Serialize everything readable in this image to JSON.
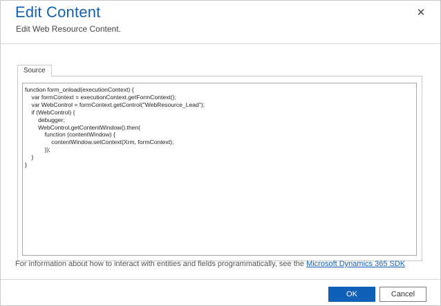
{
  "dialog": {
    "title": "Edit Content",
    "subtitle": "Edit Web Resource Content.",
    "close_symbol": "✕"
  },
  "tabs": [
    {
      "label": "Source"
    }
  ],
  "editor": {
    "lines": [
      "function form_onload(executionContext) {",
      "    var formContext = executionContext.getFormContext();",
      "    var WebControl = formContext.getControl(\"WebResource_Lead\");",
      "    if (WebControl) {",
      "        debugger;",
      "        WebControl.getContentWindow().then(",
      "            function (contentWindow) {",
      "                contentWindow.setContext(Xrm, formContext);",
      "            });",
      "    }",
      "}"
    ]
  },
  "info": {
    "text": "For information about how to interact with entities and fields programmatically, see the ",
    "link_text": "Microsoft Dynamics 365 SDK"
  },
  "buttons": {
    "ok_label": "OK",
    "cancel_label": "Cancel"
  },
  "colors": {
    "title": "#1160b7",
    "primary_button": "#1160b7",
    "link": "#1160b7"
  },
  "icons": {
    "close": "close-icon"
  }
}
